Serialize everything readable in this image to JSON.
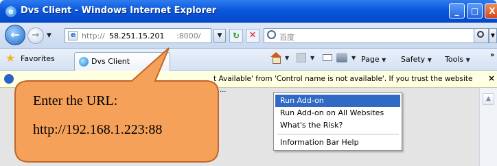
{
  "window": {
    "title": "Dvs Client - Windows Internet Explorer",
    "buttons": {
      "minimize": "_",
      "maximize": "□",
      "close": "X"
    }
  },
  "address_bar": {
    "url_prefix": "http://",
    "url_host": "58.251.15.201",
    "url_port": ":8000/",
    "search_placeholder": "百度"
  },
  "toolbar": {
    "favorites_label": "Favorites",
    "tab_label": "Dvs Client",
    "page_label": "Page",
    "safety_label": "Safety",
    "tools_label": "Tools",
    "overflow": "»"
  },
  "infobar": {
    "text": "t Available' from 'Control name is not available'. If you trust the website",
    "ellipsis": "...",
    "close": "×"
  },
  "context_menu": {
    "items": [
      {
        "label": "Run Add-on",
        "selected": true
      },
      {
        "label": "Run Add-on on All Websites",
        "selected": false
      },
      {
        "label": "What's the Risk?",
        "selected": false
      },
      {
        "label": "Information Bar Help",
        "selected": false
      }
    ]
  },
  "callout": {
    "line1": "Enter the URL:",
    "line2": "http://192.168.1.223:88",
    "fill_color": "#f6a15a",
    "border_color": "#c0662a"
  },
  "colors": {
    "titlebar": "#0a58dc",
    "menu_highlight": "#316ac5",
    "infobar_bg": "#ffffe1"
  }
}
